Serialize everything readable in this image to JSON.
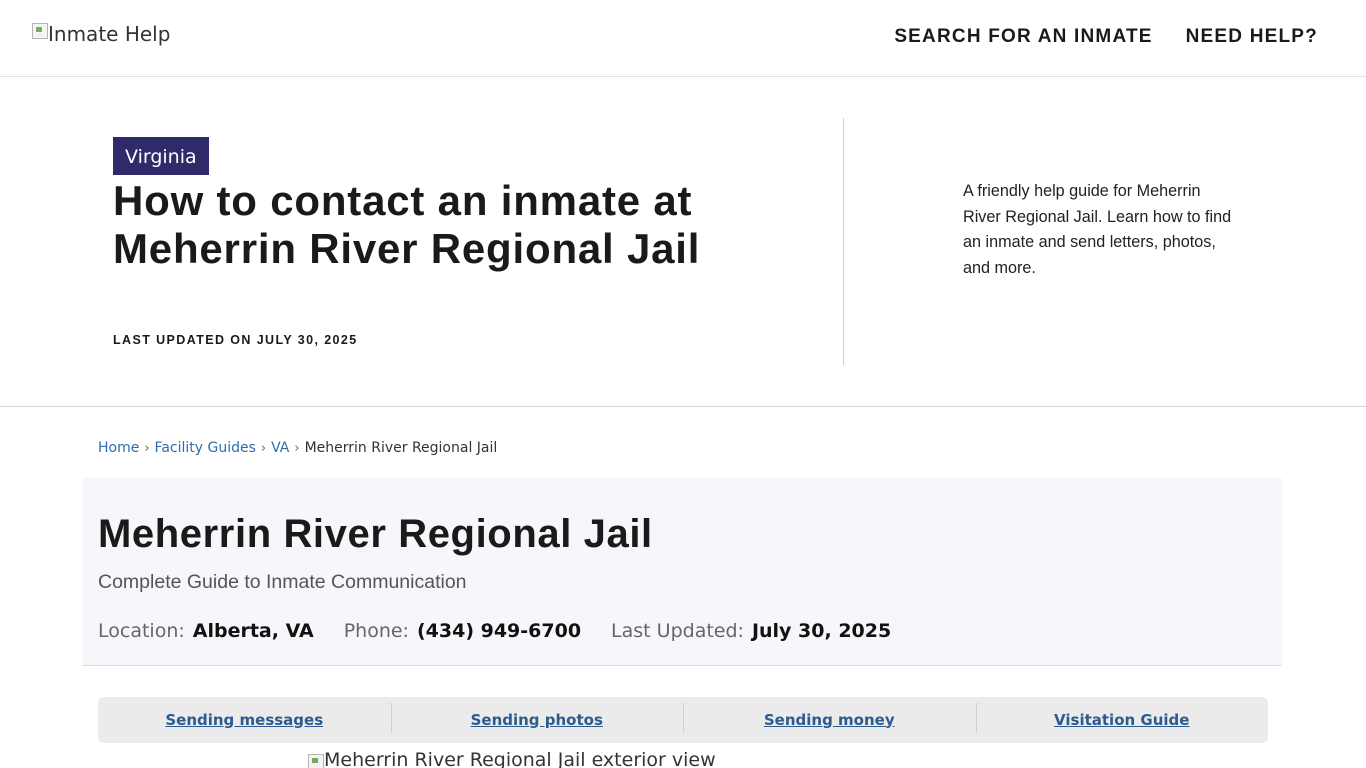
{
  "header": {
    "logo_alt": "Inmate Help",
    "nav": [
      {
        "label": "SEARCH FOR AN INMATE"
      },
      {
        "label": "NEED HELP?"
      }
    ]
  },
  "hero": {
    "state_badge": "Virginia",
    "title": "How to contact an inmate at Meherrin River Regional Jail",
    "updated": "LAST UPDATED ON JULY 30, 2025",
    "description": "A friendly help guide for Meherrin River Regional Jail. Learn how to find an inmate and send letters, photos, and more."
  },
  "breadcrumb": {
    "items": [
      "Home",
      "Facility Guides",
      "VA"
    ],
    "current": "Meherrin River Regional Jail",
    "separator": "›"
  },
  "facility": {
    "title": "Meherrin River Regional Jail",
    "subtitle": "Complete Guide to Inmate Communication",
    "location_label": "Location:",
    "location_value": "Alberta, VA",
    "phone_label": "Phone:",
    "phone_value": "(434) 949-6700",
    "updated_label": "Last Updated:",
    "updated_value": "July 30, 2025"
  },
  "quick_links": [
    {
      "label": "Sending messages"
    },
    {
      "label": "Sending photos"
    },
    {
      "label": "Sending money"
    },
    {
      "label": "Visitation Guide"
    }
  ],
  "exterior_image_alt": "Meherrin River Regional Jail exterior view",
  "colors": {
    "badge_bg": "#2f2b6b",
    "link": "#2f6cac",
    "quick_link": "#2c5c8f",
    "panel_bg": "#f5f7fa"
  }
}
